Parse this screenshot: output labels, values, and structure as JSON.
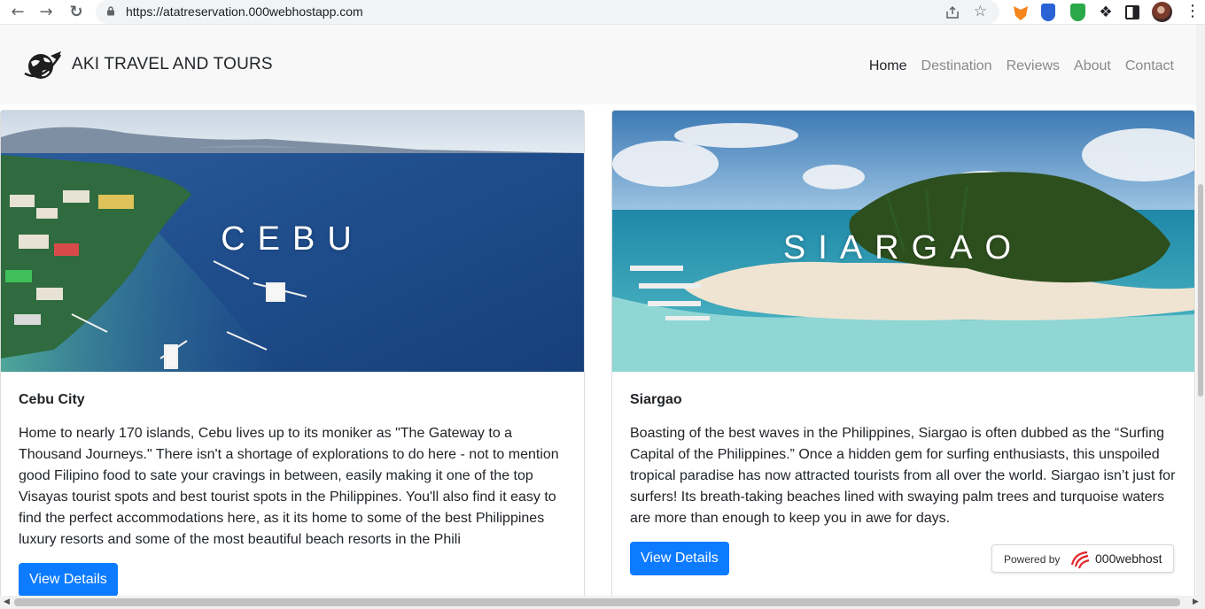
{
  "browser": {
    "url": "https://atatreservation.000webhostapp.com",
    "back_icon": "arrow-left-icon",
    "forward_icon": "arrow-right-icon",
    "reload_icon": "reload-icon"
  },
  "site": {
    "brand": "AKI TRAVEL AND TOURS",
    "nav": [
      {
        "label": "Home",
        "active": true
      },
      {
        "label": "Destination"
      },
      {
        "label": "Reviews"
      },
      {
        "label": "About"
      },
      {
        "label": "Contact"
      }
    ]
  },
  "cards": [
    {
      "hero_title": "CEBU",
      "title": "Cebu City",
      "text": "Home to nearly 170 islands, Cebu lives up to its moniker as \"The Gateway to a Thousand Journeys.\" There isn't a shortage of explorations to do here - not to mention good Filipino food to sate your cravings in between, easily making it one of the top Visayas tourist spots and best tourist spots in the Philippines. You'll also find it easy to find the perfect accommodations here, as it its home to some of the best Philippines luxury resorts and some of the most beautiful beach resorts in the Phili",
      "button": "View Details"
    },
    {
      "hero_title": "SIARGAO",
      "title": "Siargao",
      "text": "Boasting of the best waves in the Philippines, Siargao is often dubbed as the “Surfing Capital of the Philippines.” Once a hidden gem for surfing enthusiasts, this unspoiled tropical paradise has now attracted tourists from all over the world. Siargao isn’t just for surfers! Its breath-taking beaches lined with swaying palm trees and turquoise waters are more than enough to keep you in awe for days.",
      "button": "View Details"
    }
  ],
  "badge": {
    "label": "Powered by",
    "name": "000webhost"
  },
  "colors": {
    "primary": "#0d7bff",
    "navbar_bg": "#f8f8f8"
  }
}
